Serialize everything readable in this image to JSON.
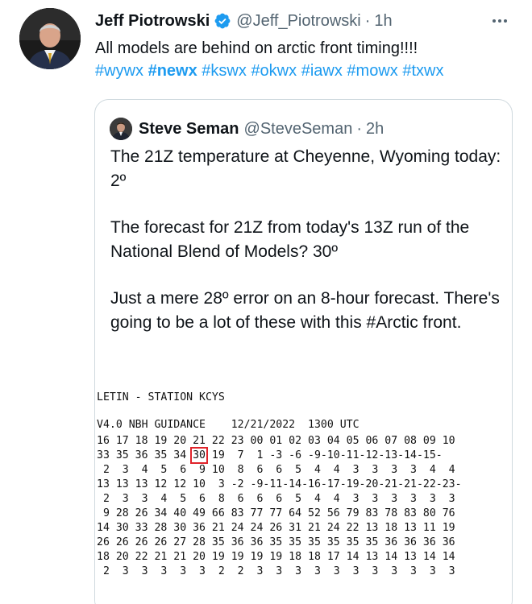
{
  "tweet": {
    "author_name": "Jeff Piotrowski",
    "handle": "@Jeff_Piotrowski",
    "separator": "·",
    "time": "1h",
    "text": "All models are behind on arctic front timing!!!!",
    "hashtags": [
      "#wywx",
      "#newx",
      "#kswx",
      "#okwx",
      "#iawx",
      "#mowx",
      "#txwx"
    ],
    "bold_hashtag_index": 1
  },
  "quote": {
    "author_name": "Steve Seman",
    "handle": "@SteveSeman",
    "separator": "·",
    "time": "2h",
    "paragraphs": [
      "The 21Z temperature at Cheyenne, Wyoming today: 2º",
      "The forecast for 21Z from today's 13Z run of the National Blend of Models? 30º",
      "Just a mere 28º error on an 8-hour forecast. There's going to be a lot of these with this #Arctic front."
    ]
  },
  "guidance": {
    "station_line": "LETIN - STATION KCYS",
    "header_line": "V4.0 NBH GUIDANCE    12/21/2022  1300 UTC",
    "rows": [
      "16 17 18 19 20 21 22 23 00 01 02 03 04 05 06 07 08 09 10",
      "33 35 36 35 34 30 19  7  1 -3 -6 -9-10-11-12-13-14-15-",
      " 2  3  4  5  6  9 10  8  6  6  5  4  4  3  3  3  3  4  4",
      "13 13 13 12 12 10  3 -2 -9-11-14-16-17-19-20-21-21-22-23-",
      " 2  3  3  4  5  6  8  6  6  6  5  4  4  3  3  3  3  3  3",
      " 9 28 26 34 40 49 66 83 77 77 64 52 56 79 83 78 83 80 76",
      "14 30 33 28 30 36 21 24 24 26 31 21 24 22 13 18 13 11 19",
      "26 26 26 26 27 28 35 36 36 35 35 35 35 35 35 36 36 36 36",
      "18 20 22 21 21 20 19 19 19 19 18 18 17 14 13 14 13 14 14",
      " 2  3  3  3  3  3  2  2  3  3  3  3  3  3  3  3  3  3  3"
    ],
    "highlight_color": "#e0242b"
  },
  "colors": {
    "link": "#1d9bf0",
    "muted": "#536471",
    "verified": "#1d9bf0"
  }
}
